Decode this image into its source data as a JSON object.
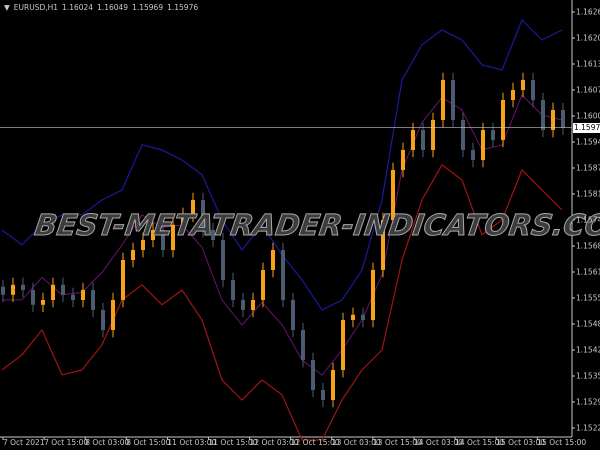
{
  "header": {
    "arrow_icon": "triangle-down-icon",
    "symbol": "EURUSD,H1",
    "open": "1.16024",
    "high": "1.16049",
    "low": "1.15969",
    "close": "1.15976"
  },
  "watermark": "BEST-METATRADER-INDICATORS.COM",
  "colors": {
    "background": "#000000",
    "bull": "#f7a21b",
    "bear": "#4c5c70",
    "upper_band": "#1a1a9c",
    "lower_band": "#a01414",
    "middle_band": "#6a1470",
    "axis": "#c8c8c8",
    "price_line": "#c8c8c8"
  },
  "chart_data": {
    "type": "candlestick",
    "ylim": [
      1.15195,
      1.16295
    ],
    "y_ticks": [
      "1.16265",
      "1.16200",
      "1.16135",
      "1.16070",
      "1.16005",
      "1.15940",
      "1.15875",
      "1.15810",
      "1.15745",
      "1.15680",
      "1.15615",
      "1.15550",
      "1.15485",
      "1.15420",
      "1.15355",
      "1.15290",
      "1.15225"
    ],
    "current_price": "1.15976",
    "x_ticks": [
      "7 Oct 2021",
      "7 Oct 15:00",
      "8 Oct 03:00",
      "8 Oct 15:00",
      "11 Oct 03:00",
      "11 Oct 15:00",
      "12 Oct 03:00",
      "12 Oct 15:00",
      "13 Oct 03:00",
      "13 Oct 15:00",
      "14 Oct 03:00",
      "14 Oct 15:00",
      "15 Oct 03:00",
      "15 Oct 15:00"
    ],
    "closes": [
      1.15558,
      1.15583,
      1.1557,
      1.15533,
      1.15545,
      1.15583,
      1.15558,
      1.15545,
      1.1557,
      1.1552,
      1.1547,
      1.15545,
      1.15645,
      1.1567,
      1.15695,
      1.1572,
      1.1567,
      1.15733,
      1.15758,
      1.15795,
      1.1572,
      1.15695,
      1.15595,
      1.15545,
      1.1552,
      1.15545,
      1.1562,
      1.1567,
      1.15545,
      1.1547,
      1.15395,
      1.1532,
      1.15295,
      1.1537,
      1.15495,
      1.15508,
      1.15495,
      1.1562,
      1.15745,
      1.1587,
      1.1592,
      1.1597,
      1.1592,
      1.15995,
      1.16095,
      1.15995,
      1.1592,
      1.15895,
      1.1597,
      1.15945,
      1.16045,
      1.1607,
      1.16095,
      1.16045,
      1.1597,
      1.1602,
      1.15976
    ],
    "upper_band": [
      1.1572,
      1.15683,
      1.15733,
      1.15758,
      1.15758,
      1.15795,
      1.1582,
      1.15933,
      1.1592,
      1.15895,
      1.15858,
      1.15745,
      1.1567,
      1.15733,
      1.15658,
      1.15595,
      1.1552,
      1.15545,
      1.1562,
      1.15795,
      1.16095,
      1.16183,
      1.1622,
      1.16195,
      1.16133,
      1.1612,
      1.16245,
      1.16195,
      1.1622
    ],
    "lower_band": [
      1.1537,
      1.15408,
      1.1547,
      1.15358,
      1.1537,
      1.15433,
      1.15545,
      1.15583,
      1.15533,
      1.1557,
      1.15495,
      1.15345,
      1.15295,
      1.15345,
      1.15308,
      1.15195,
      1.15195,
      1.15295,
      1.1537,
      1.1542,
      1.15645,
      1.15795,
      1.15883,
      1.15845,
      1.15708,
      1.15745,
      1.1587,
      1.1582,
      1.1577
    ]
  }
}
